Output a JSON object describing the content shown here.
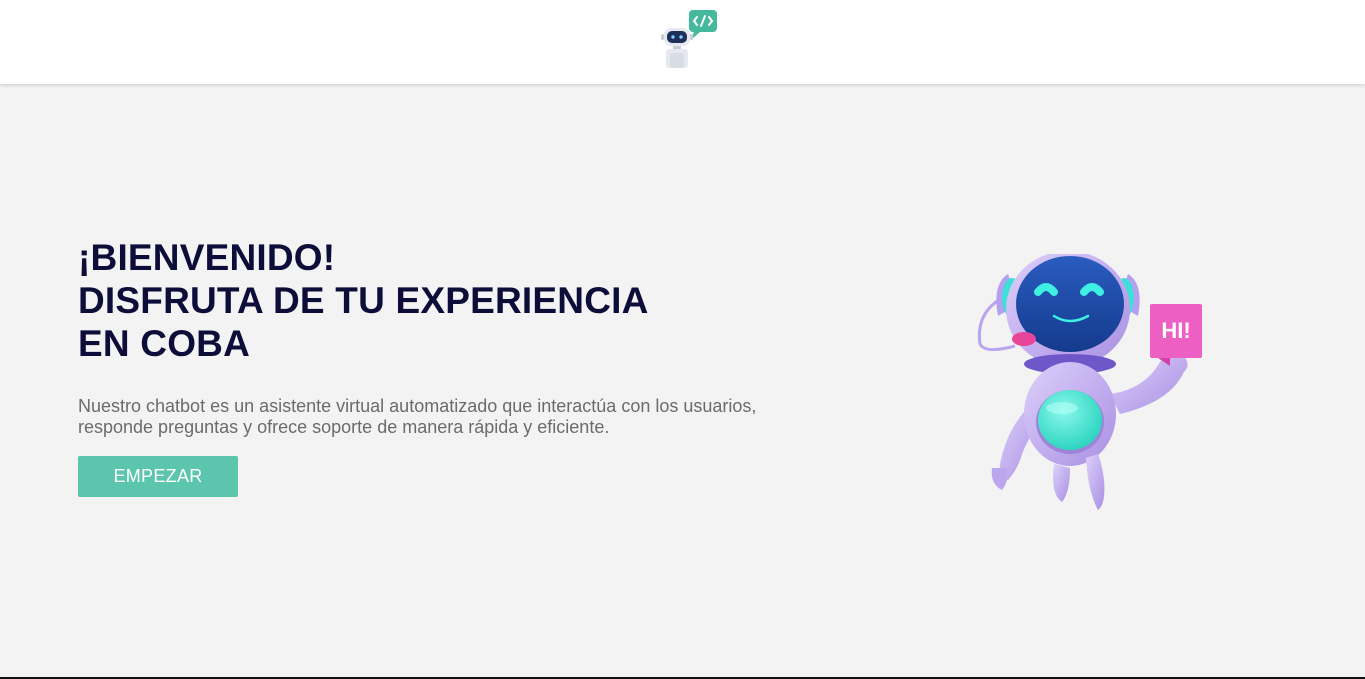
{
  "header": {
    "logo_icon": "chatbot-code-logo-icon"
  },
  "hero": {
    "title_lines": [
      "¡BIENVENIDO!",
      "DISFRUTA DE TU EXPERIENCIA",
      "EN COBA"
    ],
    "description_lines": [
      "Nuestro chatbot es un asistente virtual automatizado que interactúa con los usuarios,",
      "responde preguntas y ofrece soporte de manera rápida y eficiente."
    ],
    "start_button_label": "EMPEZAR",
    "illustration": {
      "icon": "waving-robot-illustration",
      "speech_text": "HI!"
    }
  },
  "colors": {
    "background": "#f3f3f3",
    "header": "#ffffff",
    "title": "#0d0d3a",
    "text": "#6b6b6b",
    "accent": "#5bc5ad",
    "robot_body": "#c9b8f0",
    "robot_visor": "#1e4ea8",
    "robot_glow": "#3fe6d4",
    "speech_bubble": "#ee5fc4"
  }
}
